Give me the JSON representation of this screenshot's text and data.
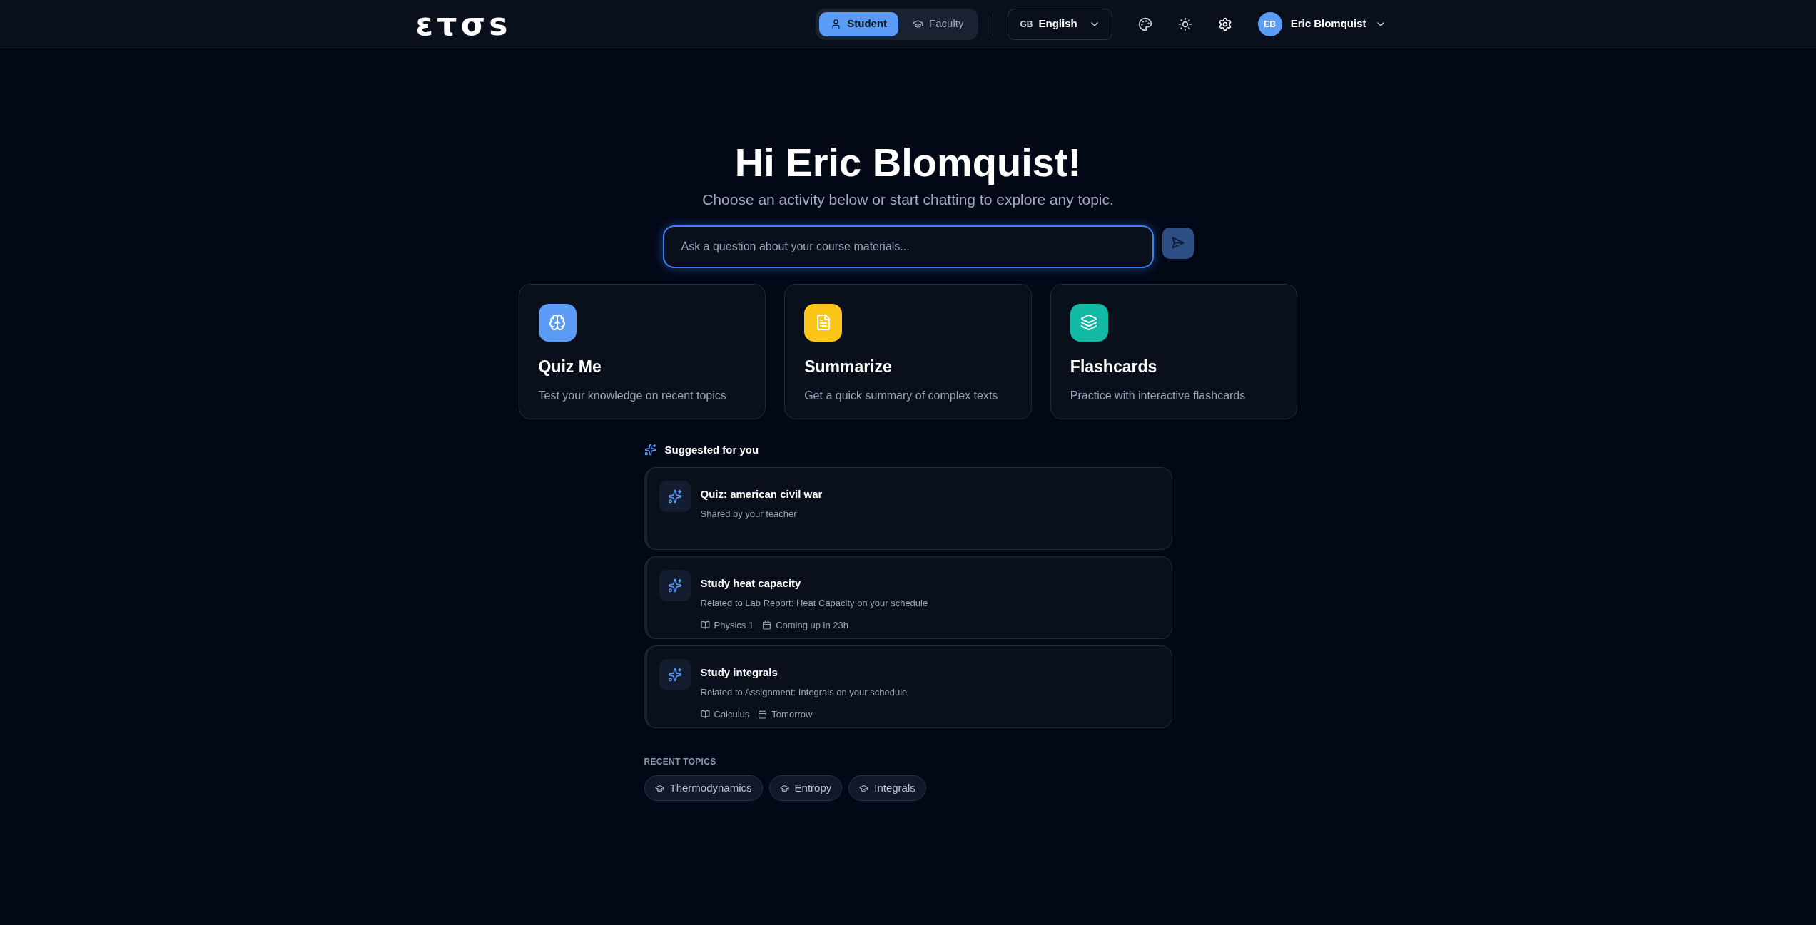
{
  "header": {
    "logo": "ετσs",
    "roles": [
      {
        "label": "Student",
        "selected": true
      },
      {
        "label": "Faculty",
        "selected": false
      }
    ],
    "language": {
      "code": "GB",
      "label": "English"
    },
    "user": {
      "initials": "EB",
      "name": "Eric Blomquist"
    }
  },
  "hero": {
    "title": "Hi Eric Blomquist!",
    "subtitle": "Choose an activity below or start chatting to explore any topic.",
    "search": {
      "placeholder": "Ask a question about your course materials..."
    }
  },
  "activities": [
    {
      "title": "Quiz Me",
      "description": "Test your knowledge on recent topics",
      "color": "#5b9cf6"
    },
    {
      "title": "Summarize",
      "description": "Get a quick summary of complex texts",
      "color": "#fbc51a"
    },
    {
      "title": "Flashcards",
      "description": "Practice with interactive flashcards",
      "color": "#12b9a5"
    }
  ],
  "suggestions": {
    "title": "Suggested for you",
    "items": [
      {
        "title": "Quiz: american civil war",
        "subtitle": "Shared by your teacher"
      },
      {
        "title": "Study heat capacity",
        "subtitle": "Related to Lab Report: Heat Capacity on your schedule",
        "course": "Physics 1",
        "due": "Coming up in 23h"
      },
      {
        "title": "Study integrals",
        "subtitle": "Related to Assignment: Integrals on your schedule",
        "course": "Calculus",
        "due": "Tomorrow"
      }
    ]
  },
  "recent_topics": {
    "title": "RECENT TOPICS",
    "items": [
      "Thermodynamics",
      "Entropy",
      "Integrals"
    ]
  }
}
